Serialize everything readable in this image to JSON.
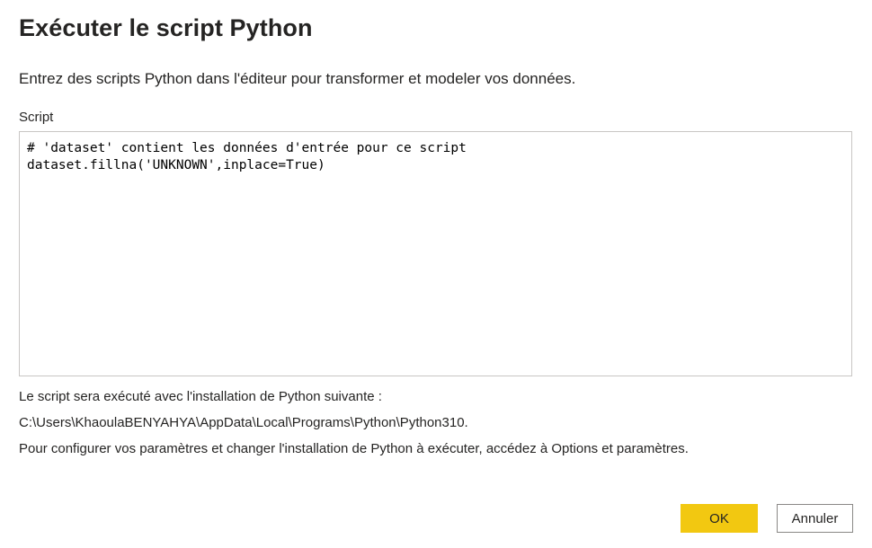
{
  "dialog": {
    "title": "Exécuter le script Python",
    "description": "Entrez des scripts Python dans l'éditeur pour transformer et modeler vos données."
  },
  "script": {
    "label": "Script",
    "lines": [
      "# 'dataset' contient les données d'entrée pour ce script",
      "dataset.fillna('UNKNOWN',inplace=True)"
    ]
  },
  "info": {
    "line1": "Le script sera exécuté avec l'installation de Python suivante :",
    "python_path": "C:\\Users\\KhaoulaBENYAHYA\\AppData\\Local\\Programs\\Python\\Python310.",
    "line3": "Pour configurer vos paramètres et changer l'installation de Python à exécuter, accédez à Options et paramètres."
  },
  "buttons": {
    "ok_label": "OK",
    "cancel_label": "Annuler"
  },
  "colors": {
    "primary_button": "#f2c811",
    "text": "#252423",
    "editor_border": "#c8c6c4"
  }
}
